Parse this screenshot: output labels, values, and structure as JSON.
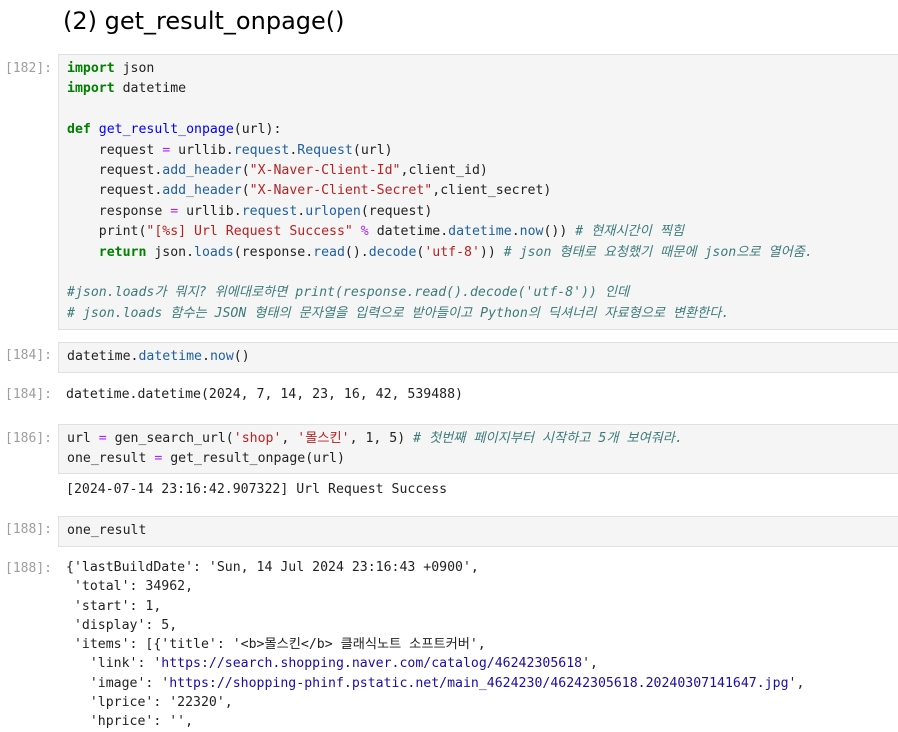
{
  "heading": "(2) get_result_onpage()",
  "cells": [
    {
      "in_prompt": "[182]:",
      "code": [
        [
          [
            "kw",
            "import"
          ],
          [
            "t",
            " json"
          ]
        ],
        [
          [
            "kw",
            "import"
          ],
          [
            "t",
            " datetime"
          ]
        ],
        [],
        [
          [
            "kw",
            "def"
          ],
          [
            "t",
            " "
          ],
          [
            "fn",
            "get_result_onpage"
          ],
          [
            "t",
            "(url):"
          ]
        ],
        [
          [
            "t",
            "    request "
          ],
          [
            "op",
            "="
          ],
          [
            "t",
            " urllib."
          ],
          [
            "attr",
            "request"
          ],
          [
            "t",
            "."
          ],
          [
            "attr",
            "Request"
          ],
          [
            "t",
            "(url)"
          ]
        ],
        [
          [
            "t",
            "    request."
          ],
          [
            "attr",
            "add_header"
          ],
          [
            "t",
            "("
          ],
          [
            "str",
            "\"X-Naver-Client-Id\""
          ],
          [
            "t",
            ",client_id)"
          ]
        ],
        [
          [
            "t",
            "    request."
          ],
          [
            "attr",
            "add_header"
          ],
          [
            "t",
            "("
          ],
          [
            "str",
            "\"X-Naver-Client-Secret\""
          ],
          [
            "t",
            ",client_secret)"
          ]
        ],
        [
          [
            "t",
            "    response "
          ],
          [
            "op",
            "="
          ],
          [
            "t",
            " urllib."
          ],
          [
            "attr",
            "request"
          ],
          [
            "t",
            "."
          ],
          [
            "attr",
            "urlopen"
          ],
          [
            "t",
            "(request)"
          ]
        ],
        [
          [
            "t",
            "    print("
          ],
          [
            "str",
            "\"[%s] Url Request Success\""
          ],
          [
            "t",
            " "
          ],
          [
            "op",
            "%"
          ],
          [
            "t",
            " datetime."
          ],
          [
            "attr",
            "datetime"
          ],
          [
            "t",
            "."
          ],
          [
            "attr",
            "now"
          ],
          [
            "t",
            "()) "
          ],
          [
            "cm",
            "# 현재시간이 찍힘"
          ]
        ],
        [
          [
            "t",
            "    "
          ],
          [
            "kw",
            "return"
          ],
          [
            "t",
            " json."
          ],
          [
            "attr",
            "loads"
          ],
          [
            "t",
            "(response."
          ],
          [
            "attr",
            "read"
          ],
          [
            "t",
            "()."
          ],
          [
            "attr",
            "decode"
          ],
          [
            "t",
            "("
          ],
          [
            "str",
            "'utf-8'"
          ],
          [
            "t",
            ")) "
          ],
          [
            "cm",
            "# json 형태로 요청했기 때문에 json으로 열어줌."
          ]
        ],
        [],
        [
          [
            "cm",
            "#json.loads가 뭐지? 위에대로하면 print(response.read().decode('utf-8')) 인데"
          ]
        ],
        [
          [
            "cm",
            "# json.loads 함수는 JSON 형태의 문자열을 입력으로 받아들이고 Python의 딕셔너리 자료형으로 변환한다."
          ]
        ]
      ]
    },
    {
      "in_prompt": "[184]:",
      "code": [
        [
          [
            "t",
            "datetime."
          ],
          [
            "attr",
            "datetime"
          ],
          [
            "t",
            "."
          ],
          [
            "attr",
            "now"
          ],
          [
            "t",
            "()"
          ]
        ]
      ],
      "out_prompt": "[184]:",
      "output": [
        "datetime.datetime(2024, 7, 14, 23, 16, 42, 539488)"
      ]
    },
    {
      "in_prompt": "[186]:",
      "code": [
        [
          [
            "t",
            "url "
          ],
          [
            "op",
            "="
          ],
          [
            "t",
            " gen_search_url("
          ],
          [
            "str",
            "'shop'"
          ],
          [
            "t",
            ", "
          ],
          [
            "str",
            "'몰스킨'"
          ],
          [
            "t",
            ", 1, 5) "
          ],
          [
            "cm",
            "# 첫번째 페이지부터 시작하고 5개 보여줘라."
          ]
        ],
        [
          [
            "t",
            "one_result "
          ],
          [
            "op",
            "="
          ],
          [
            "t",
            " get_result_onpage(url)"
          ]
        ]
      ],
      "stream": [
        "[2024-07-14 23:16:42.907322] Url Request Success"
      ]
    },
    {
      "in_prompt": "[188]:",
      "code": [
        [
          [
            "t",
            "one_result"
          ]
        ]
      ],
      "out_prompt": "[188]:",
      "output": [
        "{'lastBuildDate': 'Sun, 14 Jul 2024 23:16:43 +0900',",
        " 'total': 34962,",
        " 'start': 1,",
        " 'display': 5,",
        " 'items': [{'title': '<b>몰스킨</b> 클래식노트 소프트커버',",
        "   'link': 'https://search.shopping.naver.com/catalog/46242305618',",
        "   'image': 'https://shopping-phinf.pstatic.net/main_4624230/46242305618.20240307141647.jpg',",
        "   'lprice': '22320',",
        "   'hprice': '',"
      ]
    }
  ]
}
